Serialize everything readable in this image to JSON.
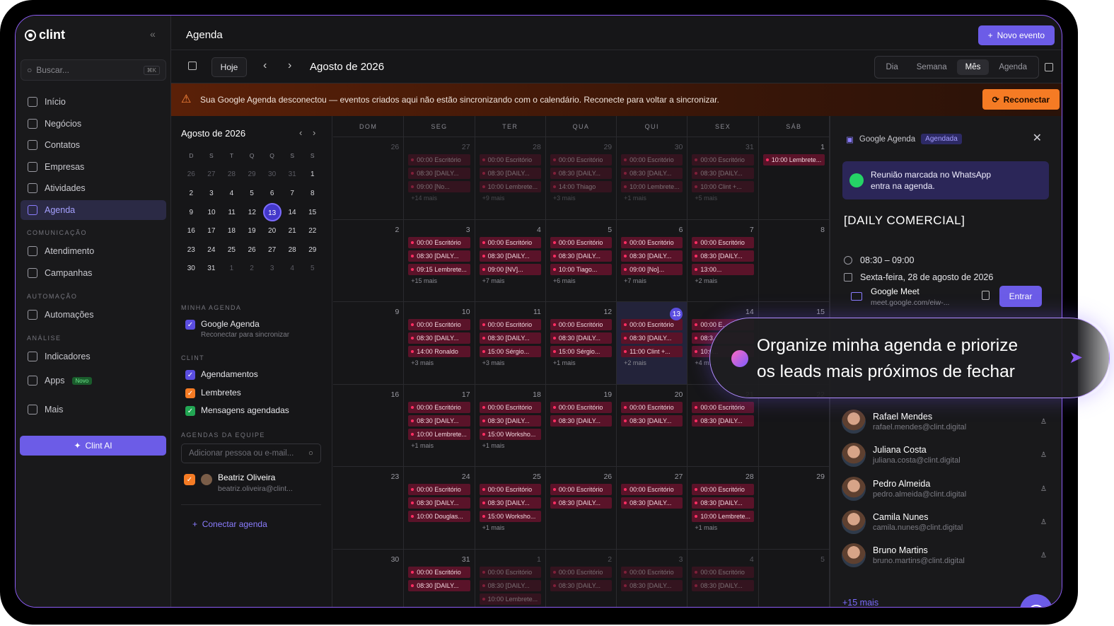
{
  "app": {
    "name": "clint",
    "page_title": "Agenda",
    "new_event": "Novo evento"
  },
  "search": {
    "placeholder": "Buscar...",
    "shortcut": "⌘K"
  },
  "nav": [
    {
      "label": "Início",
      "icon": "home-icon"
    },
    {
      "label": "Negócios",
      "icon": "deals-icon"
    },
    {
      "label": "Contatos",
      "icon": "contacts-icon"
    },
    {
      "label": "Empresas",
      "icon": "building-icon"
    },
    {
      "label": "Atividades",
      "icon": "tasks-icon"
    },
    {
      "label": "Agenda",
      "icon": "calendar-icon",
      "active": true
    }
  ],
  "sections": {
    "comunicacao": "COMUNICAÇÃO",
    "automacao": "AUTOMAÇÃO",
    "analise": "ANÁLISE"
  },
  "nav2": [
    {
      "label": "Atendimento",
      "icon": "chat-icon"
    },
    {
      "label": "Campanhas",
      "icon": "megaphone-icon"
    },
    {
      "label": "Automações",
      "icon": "lightning-icon"
    },
    {
      "label": "Indicadores",
      "icon": "chart-icon"
    },
    {
      "label": "Apps",
      "icon": "apps-icon",
      "badge": "Novo"
    },
    {
      "label": "Mais",
      "icon": "grid-icon"
    }
  ],
  "clint_ai": "Clint AI",
  "toolbar": {
    "today": "Hoje",
    "month_title": "Agosto de 2026",
    "views": [
      "Dia",
      "Semana",
      "Mês",
      "Agenda"
    ],
    "active_view": "Mês"
  },
  "alert": {
    "text": "Sua Google Agenda desconectou — eventos criados aqui não estão sincronizando com o calendário. Reconecte para voltar a sincronizar.",
    "button": "Reconectar"
  },
  "mini_calendar": {
    "title": "Agosto de 2026",
    "weekdays": [
      "D",
      "S",
      "T",
      "Q",
      "Q",
      "S",
      "S"
    ],
    "weeks": [
      [
        "26",
        "27",
        "28",
        "29",
        "30",
        "31",
        "1"
      ],
      [
        "2",
        "3",
        "4",
        "5",
        "6",
        "7",
        "8"
      ],
      [
        "9",
        "10",
        "11",
        "12",
        "13",
        "14",
        "15"
      ],
      [
        "16",
        "17",
        "18",
        "19",
        "20",
        "21",
        "22"
      ],
      [
        "23",
        "24",
        "25",
        "26",
        "27",
        "28",
        "29"
      ],
      [
        "30",
        "31",
        "1",
        "2",
        "3",
        "4",
        "5"
      ]
    ],
    "selected": "13"
  },
  "my_agenda": {
    "section": "MINHA AGENDA",
    "name": "Google Agenda",
    "sub": "Reconectar para sincronizar"
  },
  "clint_section": {
    "section": "CLINT",
    "items": [
      "Agendamentos",
      "Lembretes",
      "Mensagens agendadas"
    ]
  },
  "team": {
    "section": "AGENDAS DA EQUIPE",
    "placeholder": "Adicionar pessoa ou e-mail...",
    "person": "Beatriz Oliveira",
    "email": "beatriz.oliveira@clint..."
  },
  "connect": "Conectar agenda",
  "calendar": {
    "weekdays": [
      "DOM",
      "SEG",
      "TER",
      "QUA",
      "QUI",
      "SEX",
      "SÁB"
    ],
    "weeks": [
      [
        {
          "n": "26",
          "faded": true,
          "events": []
        },
        {
          "n": "27",
          "faded": true,
          "events": [
            "00:00 Escritório",
            "08:30 [DAILY...",
            "09:00 [No..."
          ],
          "more": "+14 mais"
        },
        {
          "n": "28",
          "faded": true,
          "events": [
            "00:00 Escritório",
            "08:30 [DAILY...",
            "10:00 Lembrete..."
          ],
          "more": "+9 mais"
        },
        {
          "n": "29",
          "faded": true,
          "events": [
            "00:00 Escritório",
            "08:30 [DAILY...",
            "14:00 Thiago"
          ],
          "more": "+3 mais"
        },
        {
          "n": "30",
          "faded": true,
          "events": [
            "00:00 Escritório",
            "08:30 [DAILY...",
            "10:00 Lembrete..."
          ],
          "more": "+1 mais"
        },
        {
          "n": "31",
          "faded": true,
          "events": [
            "00:00 Escritório",
            "08:30 [DAILY...",
            "10:00 Clint +..."
          ],
          "more": "+5 mais"
        },
        {
          "n": "1",
          "events": [
            "10:00 Lembrete..."
          ]
        }
      ],
      [
        {
          "n": "2",
          "events": []
        },
        {
          "n": "3",
          "events": [
            "00:00 Escritório",
            "08:30 [DAILY...",
            "09:15 Lembrete..."
          ],
          "more": "+15 mais"
        },
        {
          "n": "4",
          "events": [
            "00:00 Escritório",
            "08:30 [DAILY...",
            "09:00 [NV]..."
          ],
          "more": "+7 mais"
        },
        {
          "n": "5",
          "events": [
            "00:00 Escritório",
            "08:30 [DAILY...",
            "10:00 Tiago..."
          ],
          "more": "+6 mais"
        },
        {
          "n": "6",
          "events": [
            "00:00 Escritório",
            "08:30 [DAILY...",
            "09:00 [No]..."
          ],
          "more": "+7 mais"
        },
        {
          "n": "7",
          "events": [
            "00:00 Escritório",
            "08:30 [DAILY...",
            "13:00..."
          ],
          "more": "+2 mais"
        },
        {
          "n": "8",
          "events": []
        }
      ],
      [
        {
          "n": "9",
          "events": []
        },
        {
          "n": "10",
          "events": [
            "00:00 Escritório",
            "08:30 [DAILY...",
            "14:00 Ronaldo"
          ],
          "more": "+3 mais"
        },
        {
          "n": "11",
          "events": [
            "00:00 Escritório",
            "08:30 [DAILY...",
            "15:00 Sérgio..."
          ],
          "more": "+3 mais"
        },
        {
          "n": "12",
          "events": [
            "00:00 Escritório",
            "08:30 [DAILY...",
            "15:00 Sérgio..."
          ],
          "more": "+1 mais"
        },
        {
          "n": "13",
          "today": true,
          "events": [
            "00:00 Escritório",
            "08:30 [DAILY...",
            "11:00 Clint +..."
          ],
          "more": "+2 mais"
        },
        {
          "n": "14",
          "events": [
            "00:00 E...",
            "08:3...",
            "10:0..."
          ],
          "more": "+4 m..."
        },
        {
          "n": "15",
          "events": []
        }
      ],
      [
        {
          "n": "16",
          "events": []
        },
        {
          "n": "17",
          "events": [
            "00:00 Escritório",
            "08:30 [DAILY...",
            "10:00 Lembrete..."
          ],
          "more": "+1 mais"
        },
        {
          "n": "18",
          "events": [
            "00:00 Escritório",
            "08:30 [DAILY...",
            "15:00 Worksho..."
          ],
          "more": "+1 mais"
        },
        {
          "n": "19",
          "events": [
            "00:00 Escritório",
            "08:30 [DAILY..."
          ]
        },
        {
          "n": "20",
          "events": [
            "00:00 Escritório",
            "08:30 [DAILY..."
          ]
        },
        {
          "n": "21",
          "events": [
            "00:00 Escritório",
            "08:30 [DAILY..."
          ]
        },
        {
          "n": "22",
          "events": []
        }
      ],
      [
        {
          "n": "23",
          "events": []
        },
        {
          "n": "24",
          "events": [
            "00:00 Escritório",
            "08:30 [DAILY...",
            "10:00 Douglas..."
          ]
        },
        {
          "n": "25",
          "events": [
            "00:00 Escritório",
            "08:30 [DAILY...",
            "15:00 Worksho..."
          ],
          "more": "+1 mais"
        },
        {
          "n": "26",
          "events": [
            "00:00 Escritório",
            "08:30 [DAILY..."
          ]
        },
        {
          "n": "27",
          "events": [
            "00:00 Escritório",
            "08:30 [DAILY..."
          ]
        },
        {
          "n": "28",
          "events": [
            "00:00 Escritório",
            "08:30 [DAILY...",
            "10:00 Lembrete..."
          ],
          "more": "+1 mais"
        },
        {
          "n": "29",
          "events": []
        }
      ],
      [
        {
          "n": "30",
          "events": []
        },
        {
          "n": "31",
          "events": [
            "00:00 Escritório",
            "08:30 [DAILY..."
          ]
        },
        {
          "n": "1",
          "faded": true,
          "events": [
            "00:00 Escritório",
            "08:30 [DAILY...",
            "10:00 Lembrete..."
          ]
        },
        {
          "n": "2",
          "faded": true,
          "events": [
            "00:00 Escritório",
            "08:30 [DAILY..."
          ]
        },
        {
          "n": "3",
          "faded": true,
          "events": [
            "00:00 Escritório",
            "08:30 [DAILY..."
          ]
        },
        {
          "n": "4",
          "faded": true,
          "events": [
            "00:00 Escritório",
            "08:30 [DAILY..."
          ]
        },
        {
          "n": "5",
          "faded": true,
          "events": []
        }
      ]
    ]
  },
  "event_panel": {
    "source": "Google Agenda",
    "tag": "Agendada",
    "notice": "Reunião marcada no WhatsApp entra na agenda.",
    "title": "[DAILY COMERCIAL]",
    "time": "08:30 – 09:00",
    "date": "Sexta-feira, 28 de agosto de 2026",
    "meet_name": "Google Meet",
    "meet_url": "meet.google.com/eiw-...",
    "enter": "Entrar",
    "guests": [
      {
        "name": "Rafael Mendes",
        "email": "rafael.mendes@clint.digital"
      },
      {
        "name": "Juliana Costa",
        "email": "juliana.costa@clint.digital"
      },
      {
        "name": "Pedro Almeida",
        "email": "pedro.almeida@clint.digital"
      },
      {
        "name": "Camila Nunes",
        "email": "camila.nunes@clint.digital"
      },
      {
        "name": "Bruno Martins",
        "email": "bruno.martins@clint.digital"
      }
    ],
    "more": "+15 mais"
  },
  "ai_prompt": {
    "line1": "Organize minha agenda e priorize",
    "line2": "os leads mais próximos de fechar"
  },
  "colors": {
    "accent": "#6c5ce7",
    "event_bg": "#5a1329",
    "event_dot": "#ff2e63",
    "alert": "#f57b24",
    "frame": "#8d5cf6"
  }
}
